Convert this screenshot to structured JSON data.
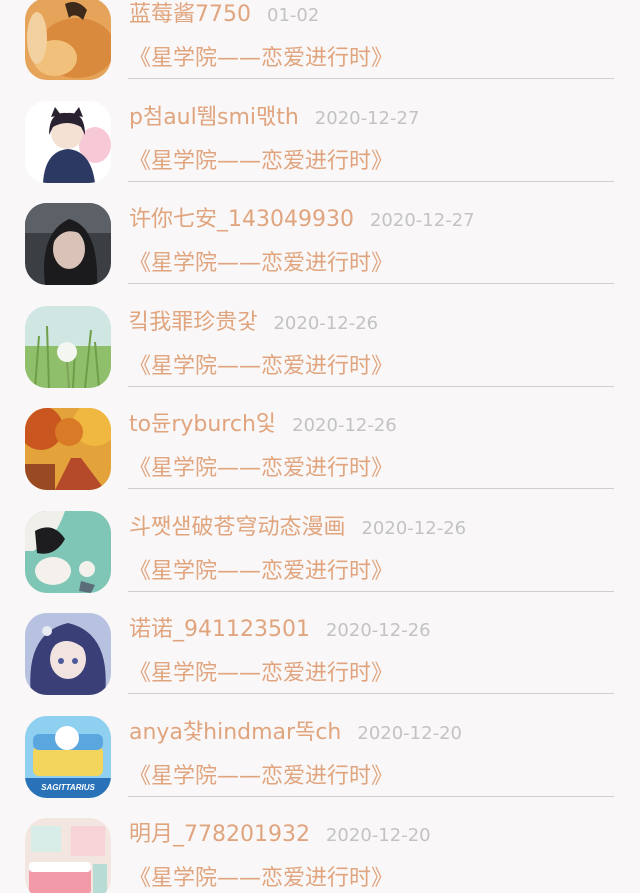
{
  "feed": {
    "items": [
      {
        "username": "蓝莓酱7750",
        "date": "01-02",
        "work_title": "《星学院——恋爱进行时》",
        "avatar": "orange-cat-avatar"
      },
      {
        "username": "p첨aul뛤smi맧th",
        "date": "2020-12-27",
        "work_title": "《星学院——恋爱进行时》",
        "avatar": "anime-girl-hoodie-avatar"
      },
      {
        "username": "许你七安_143049930",
        "date": "2020-12-27",
        "work_title": "《星学院——恋爱进行时》",
        "avatar": "dark-hair-portrait-avatar"
      },
      {
        "username": "킼我罪珍贵갗",
        "date": "2020-12-26",
        "work_title": "《星学院——恋爱进行时》",
        "avatar": "dandelion-field-avatar"
      },
      {
        "username": "to듄ryburch잋",
        "date": "2020-12-26",
        "work_title": "《星学院——恋爱进行时》",
        "avatar": "autumn-road-avatar"
      },
      {
        "username": "斗쨋샏破苍穹动态漫画",
        "date": "2020-12-26",
        "work_title": "《星学院——恋爱进行时》",
        "avatar": "teal-anime-couple-avatar"
      },
      {
        "username": "诺诺_941123501",
        "date": "2020-12-26",
        "work_title": "《星学院——恋爱进行时》",
        "avatar": "blue-hair-anime-avatar"
      },
      {
        "username": "anya챷hindmar똑ch",
        "date": "2020-12-20",
        "work_title": "《星学院——恋爱进行时》",
        "avatar": "sagittarius-avatar",
        "avatar_caption": "SAGITTARIUS"
      },
      {
        "username": "明月_778201932",
        "date": "2020-12-20",
        "work_title": "《星学院——恋爱进行时》",
        "avatar": "pink-bedroom-avatar"
      }
    ]
  },
  "colors": {
    "accent": "#e0a57e",
    "date": "#c3c3c3",
    "divider": "#cfcfcf",
    "background": "#f9f7f8"
  }
}
